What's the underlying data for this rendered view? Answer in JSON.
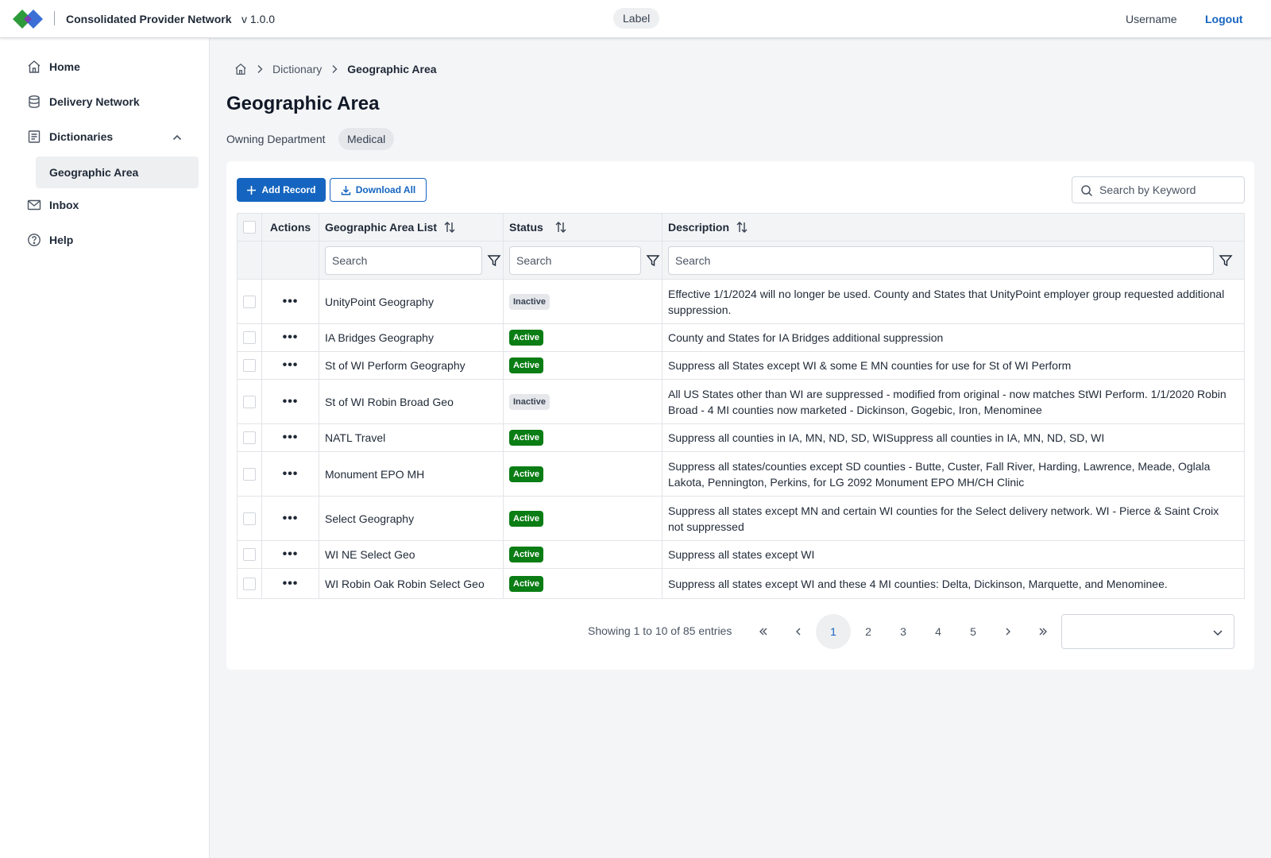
{
  "header": {
    "app_title": "Consolidated Provider Network",
    "version": "v 1.0.0",
    "label": "Label",
    "username": "Username",
    "logout": "Logout"
  },
  "sidebar": {
    "items": [
      {
        "label": "Home",
        "icon": "home-icon"
      },
      {
        "label": "Delivery Network",
        "icon": "database-icon"
      },
      {
        "label": "Dictionaries",
        "icon": "document-list-icon"
      },
      {
        "label": "Inbox",
        "icon": "mail-icon"
      },
      {
        "label": "Help",
        "icon": "help-circle-icon"
      }
    ],
    "subitems": [
      {
        "label": "Geographic Area",
        "selected": true
      }
    ]
  },
  "breadcrumb": {
    "items": [
      "Dictionary",
      "Geographic Area"
    ]
  },
  "page": {
    "title": "Geographic Area",
    "owning_label": "Owning Department",
    "owning_value": "Medical"
  },
  "toolbar": {
    "add_label": "Add Record",
    "download_label": "Download All",
    "search_placeholder": "Search by Keyword"
  },
  "table": {
    "columns": {
      "actions": "Actions",
      "name": "Geographic Area List",
      "status": "Status",
      "description": "Description"
    },
    "filter_placeholder": "Search",
    "actions_glyph": "•••",
    "rows": [
      {
        "name": "UnityPoint Geography",
        "status": "Inactive",
        "description": "Effective 1/1/2024 will no longer be used. County and States that UnityPoint employer group requested additional suppression."
      },
      {
        "name": "IA Bridges Geography",
        "status": "Active",
        "description": "County and States for IA Bridges additional suppression"
      },
      {
        "name": "St of WI Perform Geography",
        "status": "Active",
        "description": "Suppress all States except WI & some E MN counties for use for St of WI Perform"
      },
      {
        "name": "St of WI Robin Broad Geo",
        "status": "Inactive",
        "description": "All US States other than WI are suppressed - modified from original - now matches StWI Perform. 1/1/2020 Robin Broad - 4 MI counties now marketed - Dickinson, Gogebic, Iron, Menominee"
      },
      {
        "name": "NATL Travel",
        "status": "Active",
        "description": "Suppress all counties in IA, MN, ND, SD, WISuppress all counties in IA, MN, ND, SD, WI"
      },
      {
        "name": "Monument EPO MH",
        "status": "Active",
        "description": "Suppress all states/counties except  SD counties - Butte, Custer, Fall River, Harding, Lawrence, Meade, Oglala Lakota, Pennington, Perkins, for LG 2092 Monument EPO MH/CH Clinic"
      },
      {
        "name": "Select Geography",
        "status": "Active",
        "description": "Suppress all states except MN and certain WI counties for the Select delivery network. WI - Pierce & Saint Croix not suppressed"
      },
      {
        "name": "WI NE Select Geo",
        "status": "Active",
        "description": "Suppress all states except WI"
      },
      {
        "name": "WI Robin Oak Robin Select Geo",
        "status": "Active",
        "description": "Suppress all states except WI and these 4 MI counties: Delta, Dickinson, Marquette, and Menominee."
      }
    ]
  },
  "pagination": {
    "summary": "Showing 1 to 10 of 85 entries",
    "pages": [
      "1",
      "2",
      "3",
      "4",
      "5"
    ],
    "current": "1",
    "page_size": ""
  },
  "colors": {
    "primary": "#1565c0",
    "active_badge": "#0a7d14",
    "inactive_badge": "#e5e7eb",
    "logo_green": "#2e9b3a",
    "logo_blue": "#3b6fd6"
  }
}
